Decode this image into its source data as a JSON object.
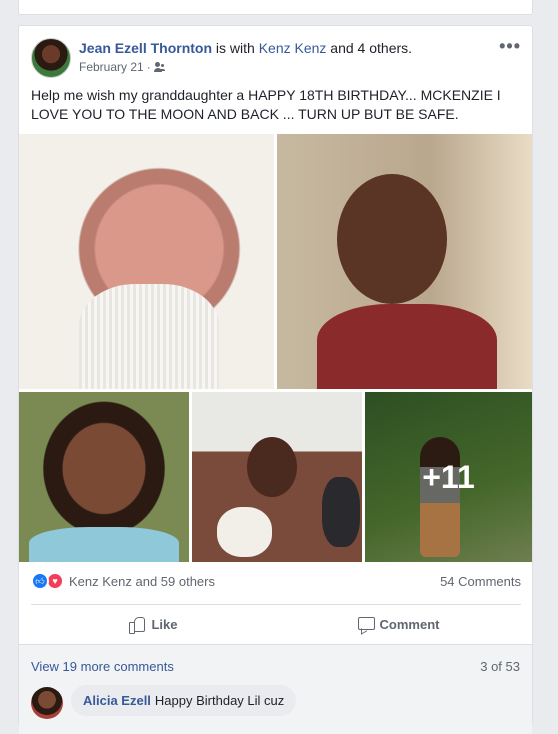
{
  "post": {
    "author": "Jean Ezell Thornton",
    "with_text": " is with ",
    "tagged": "Kenz Kenz",
    "and_others": " and 4 others.",
    "date": "February 21",
    "date_sep": "·",
    "privacy_icon": "friends-icon",
    "more_label": "•••",
    "text": "Help me wish my granddaughter a HAPPY 18TH BIRTHDAY... MCKENZIE I LOVE YOU TO THE MOON AND BACK ... TURN UP BUT BE SAFE.",
    "photo_overflow": "+11"
  },
  "reactions": {
    "icons": [
      "like-icon",
      "love-icon"
    ],
    "summary": "Kenz Kenz and 59 others",
    "comments": "54 Comments"
  },
  "actions": {
    "like": "Like",
    "comment": "Comment"
  },
  "comments": {
    "view_more": "View 19 more comments",
    "pagination": "3 of 53",
    "items": [
      {
        "author": "Alicia Ezell",
        "text": "Happy Birthday Lil cuz"
      }
    ]
  },
  "colors": {
    "link": "#385898",
    "like": "#1877f2",
    "love": "#f33e58"
  }
}
